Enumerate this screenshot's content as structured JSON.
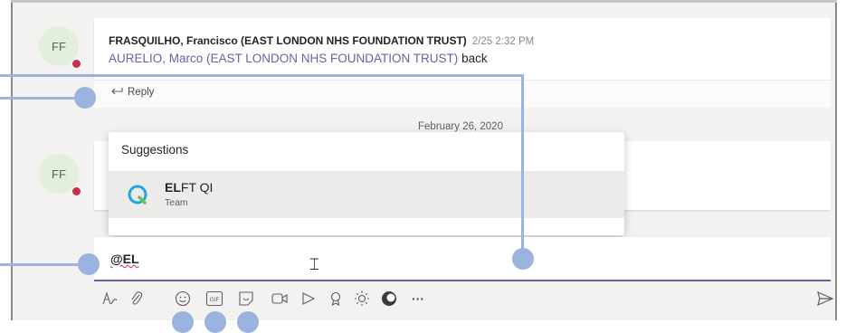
{
  "message": {
    "avatar_initials": "FF",
    "author": "FRASQUILHO, Francisco (EAST LONDON NHS FOUNDATION TRUST)",
    "timestamp": "2/25 2:32 PM",
    "mention": "AURELIO, Marco (EAST LONDON NHS FOUNDATION TRUST)",
    "body_text": "back",
    "reply_label": "Reply"
  },
  "second_avatar_initials": "FF",
  "date_separator": "February 26, 2020",
  "suggestions": {
    "title": "Suggestions",
    "items": [
      {
        "name_bold": "EL",
        "name_rest": "FT QI",
        "subtitle": "Team"
      }
    ]
  },
  "compose": {
    "value": "@EL"
  },
  "toolbar": {
    "icons": [
      "format-icon",
      "attach-icon",
      "emoji-icon",
      "gif-icon",
      "sticker-icon",
      "meet-now-icon",
      "stream-icon",
      "praise-icon",
      "brightness-icon",
      "app-icon",
      "more-options-icon"
    ],
    "more_label": "···"
  },
  "colors": {
    "accent": "#6264a7",
    "callout": "#9bb3df",
    "presence": "#c4314b"
  }
}
